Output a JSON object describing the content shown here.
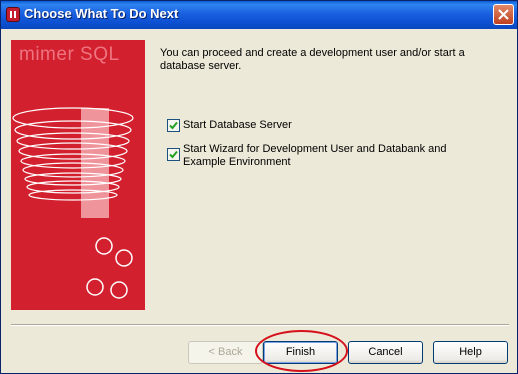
{
  "window": {
    "title": "Choose What To Do Next"
  },
  "banner": {
    "logo": "mimer SQL"
  },
  "content": {
    "intro": "You can proceed and create a development user and/or start a database server.",
    "options": [
      {
        "label": "Start Database Server",
        "checked": true
      },
      {
        "label": "Start Wizard for Development User and Databank and Example Environment",
        "checked": true
      }
    ]
  },
  "buttons": {
    "back": "< Back",
    "finish": "Finish",
    "cancel": "Cancel",
    "help": "Help"
  },
  "colors": {
    "banner": "#d3202f",
    "titlebar": "#0a5bd6",
    "annotation": "#d6101a"
  }
}
